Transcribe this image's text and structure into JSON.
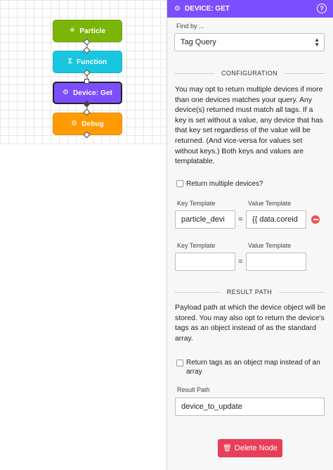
{
  "canvas": {
    "nodes": [
      {
        "icon": "✳",
        "label": "Particle",
        "color": "#7cb50a"
      },
      {
        "icon": "Σ",
        "label": "Function",
        "color": "#19c6df"
      },
      {
        "icon": "⚙",
        "label": "Device: Get",
        "color": "#7b4eff"
      },
      {
        "icon": "⚙",
        "label": "Debug",
        "color": "#ff9b00"
      }
    ]
  },
  "panel": {
    "title": "DEVICE: GET",
    "help_icon": "?",
    "find_by_label": "Find by ...",
    "find_by_value": "Tag Query",
    "configuration_title": "CONFIGURATION",
    "configuration_text": "You may opt to return multiple devices if more than one devices matches your query. Any device(s) returned must match all tags. If a key is set without a value, any device that has that key set regardless of the value will be returned. (And vice-versa for values set without keys.) Both keys and values are templatable.",
    "return_multiple_label": "Return multiple devices?",
    "tag_rows": [
      {
        "key_label": "Key Template",
        "value_label": "Value Template",
        "key": "particle_devi",
        "value": "{{ data.coreid"
      },
      {
        "key_label": "Key Template",
        "value_label": "Value Template",
        "key": "",
        "value": ""
      }
    ],
    "equals": "=",
    "result_path_title": "RESULT PATH",
    "result_path_text": "Payload path at which the device object will be stored. You may also opt to return the device's tags as an object instead of as the standard array.",
    "tags_as_object_label": "Return tags as an object map instead of an array",
    "result_path_label": "Result Path",
    "result_path_value": "device_to_update",
    "delete_label": "Delete Node",
    "accent_color": "#7b4eff",
    "delete_color": "#e93e58"
  }
}
